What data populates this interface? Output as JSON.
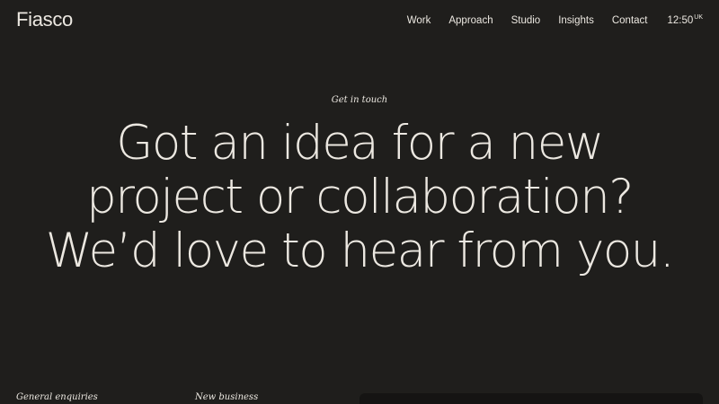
{
  "header": {
    "logo": "Fiasco",
    "nav": [
      "Work",
      "Approach",
      "Studio",
      "Insights",
      "Contact"
    ],
    "clock": {
      "time": "12:50",
      "region": "UK"
    }
  },
  "hero": {
    "eyebrow": "Get in touch",
    "headline_lines": [
      "Got an idea for a new",
      "project or collaboration?",
      "We’d love to hear from you."
    ]
  },
  "footer": {
    "general_enquiries": "General enquiries",
    "new_business": "New business"
  },
  "colors": {
    "background": "#1f1e1c",
    "text": "#ece8e1",
    "panel": "#151413"
  }
}
